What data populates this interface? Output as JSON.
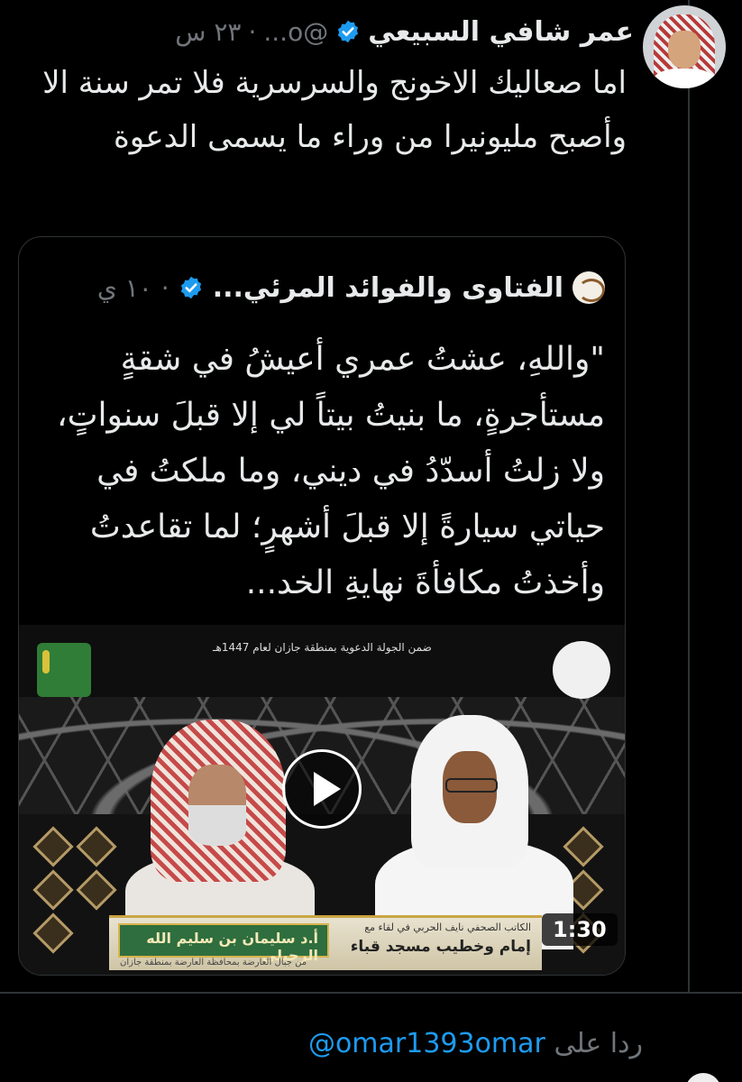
{
  "tweet": {
    "author_name": "عمر شافي السبيعي",
    "handle": "@o...",
    "timestamp": "٢٣ س",
    "separator": "·",
    "text": "اما صعاليك الاخونج والسرسرية  فلا تمر سنة الا وأصبح مليونيرا من وراء ما يسمى الدعوة"
  },
  "quoted_tweet": {
    "author_name": "الفتاوى والفوائد المرئي...",
    "timestamp": "١٠ ي",
    "separator": "·",
    "text": "\"واللهِ، عشتُ عمري أعيشُ في شقةٍ مستأجرةٍ، ما بنيتُ بيتاً لي إلا قبلَ سنواتٍ، ولا زلتُ أسدّدُ في ديني، وما ملكتُ في حياتي سيارةً إلا قبلَ أشهرٍ؛ لما تقاعدتُ وأخذتُ مكافأةَ نهايةِ الخد..."
  },
  "video": {
    "duration": "1:30",
    "banner_text": "ضمن الجولة الدعوية بمنطقة جازان لعام 1447هـ",
    "lower_third_name": "أ.د سليمان بن سليم الله الرحيلي",
    "lower_third_title": "الكاتب الصحفي نايف الحربي في لقاء مع",
    "lower_third_subtitle": "إمام وخطيب مسجد قباء",
    "lower_third_bottom": "من جبال العارضة بمحافظة العارضة بمنطقة جازان"
  },
  "reply": {
    "prefix": "ردا على",
    "handle": "@omar1393omar"
  },
  "colors": {
    "background": "#000000",
    "text": "#e7e9ea",
    "muted": "#71767b",
    "link": "#1d9bf0",
    "verified": "#1d9bf0",
    "border": "#2f3336"
  },
  "icons": {
    "verified": "verified-badge-icon",
    "play": "play-icon"
  }
}
